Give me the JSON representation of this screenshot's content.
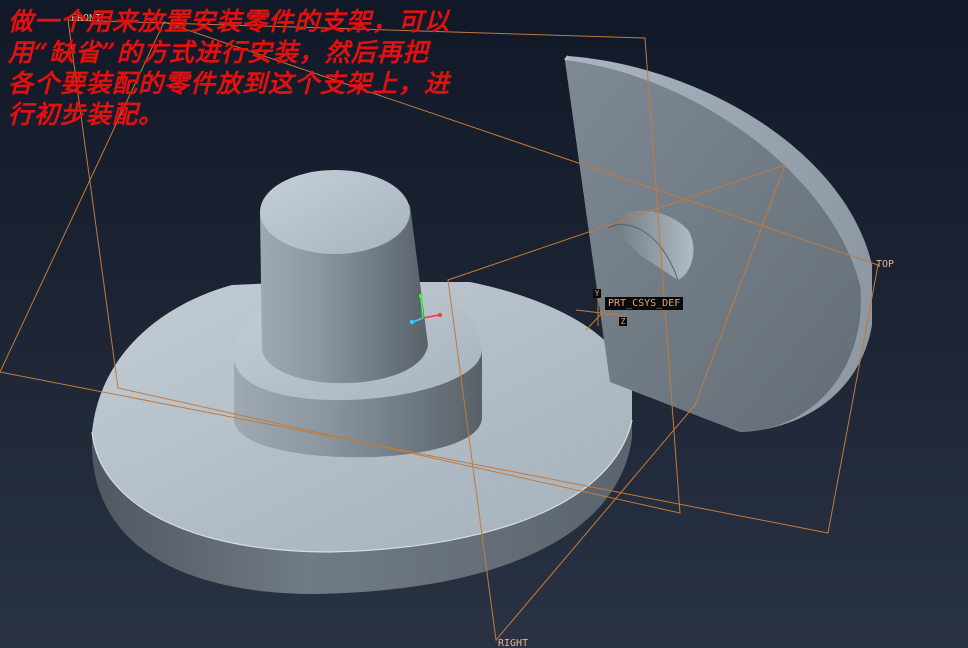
{
  "annotation": {
    "text": "做一个用来放置安装零件的支架，可以\n用“缺省”的方式进行安装，然后再把\n各个要装配的零件放到这个支架上，进\n行初步装配。"
  },
  "datum_planes": {
    "front": "FRONT",
    "top": "TOP",
    "right": "RIGHT"
  },
  "coordinate_system": {
    "name": "PRT_CSYS_DEF",
    "axis_y": "Y",
    "axis_z": "Z"
  },
  "colors": {
    "background_top": "#111827",
    "background_bottom": "#2a3343",
    "datum_plane": "#c27a3c",
    "annotation_text": "#e31010",
    "part_light": "#b4c0ca",
    "part_mid": "#8a959f",
    "part_dark": "#5b646d"
  }
}
